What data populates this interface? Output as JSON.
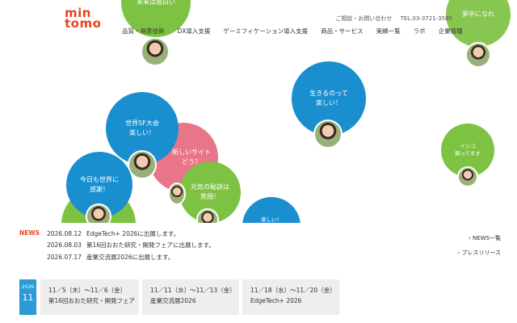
{
  "brand": {
    "logo_top": "min",
    "logo_bottom": "tomo"
  },
  "util": {
    "contact": "ご相談・お問い合わせ",
    "tel": "TEL.03-3721-3585"
  },
  "nav": [
    "品質・得意技術",
    "DX導入支援",
    "ゲーミフィケーション導入支援",
    "商品・サービス",
    "実績一覧",
    "ラボ",
    "企業情報"
  ],
  "bubbles": [
    {
      "text": "未来は面白い",
      "color": "green"
    },
    {
      "text": "夢中になれ",
      "color": "green"
    },
    {
      "text": "生きるのって\n楽しい！",
      "color": "blue"
    },
    {
      "text": "世界SF大会\n楽しい！",
      "color": "blue"
    },
    {
      "text": "新しいサイト\nどう？",
      "color": "pink"
    },
    {
      "text": "元気の秘訣は\n笑顔！",
      "color": "green"
    },
    {
      "text": "今日も世界に\n感謝！",
      "color": "blue"
    },
    {
      "text": "インコ\n飼ってます",
      "color": "green"
    },
    {
      "text": "楽しい！",
      "color": "blue"
    }
  ],
  "news": {
    "label": "NEWS",
    "items": [
      {
        "date": "2026.08.12",
        "title": "EdgeTech+ 2026に出展します。"
      },
      {
        "date": "2026.08.03",
        "title": "第16回おおた研究・開発フェアに出展します。"
      },
      {
        "date": "2026.07.17",
        "title": "産業交流展2026に出展します。"
      }
    ],
    "link_list": "› NEWS一覧",
    "link_press": "› プレスリリース"
  },
  "events": {
    "year": "2026",
    "month": "11",
    "items": [
      {
        "dates": "11／5（木）～11／6（金）",
        "name": "第16回おおた研究・開発フェア"
      },
      {
        "dates": "11／11（水）～11／13（金）",
        "name": "産業交流展2026"
      },
      {
        "dates": "11／18（水）～11／20（金）",
        "name": "EdgeTech+ 2026"
      }
    ]
  }
}
